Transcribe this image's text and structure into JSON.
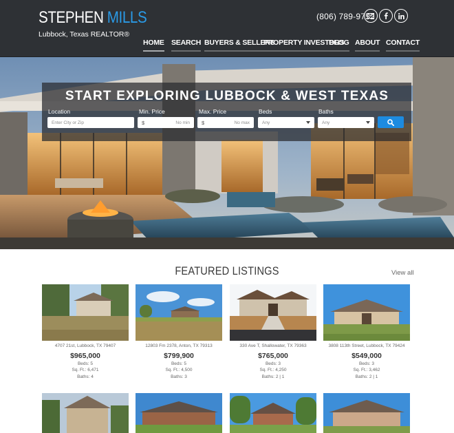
{
  "header": {
    "brand_first": "STEPHEN",
    "brand_last": "MILLS",
    "tagline": "Lubbock, Texas REALTOR®",
    "phone": "(806) 789-9752",
    "social": [
      "mail-icon",
      "facebook-icon",
      "linkedin-icon"
    ],
    "nav": [
      {
        "label": "HOME",
        "active": true
      },
      {
        "label": "SEARCH"
      },
      {
        "label": "BUYERS & SELLERS"
      },
      {
        "label": "PROPERTY INVESTORS"
      },
      {
        "label": "BLOG"
      },
      {
        "label": "ABOUT"
      },
      {
        "label": "CONTACT"
      }
    ]
  },
  "hero": {
    "title": "START EXPLORING LUBBOCK & WEST TEXAS",
    "fields": {
      "location_label": "Location",
      "location_placeholder": "Enter City or Zip",
      "min_price_label": "Min. Price",
      "min_price_symbol": "$",
      "min_price_placeholder": "No min",
      "max_price_label": "Max. Price",
      "max_price_symbol": "$",
      "max_price_placeholder": "No max",
      "beds_label": "Beds",
      "beds_value": "Any",
      "baths_label": "Baths",
      "baths_value": "Any"
    }
  },
  "featured": {
    "title": "FEATURED LISTINGS",
    "view_all": "View all",
    "listings": [
      {
        "address": "4707 21st, Lubbock, TX 79407",
        "price": "$965,000",
        "beds": "Beds: 5",
        "sqft": "Sq. Ft.: 6,471",
        "baths": "Baths: 4"
      },
      {
        "address": "12803 Fm 2378, Anton, TX 79313",
        "price": "$799,900",
        "beds": "Beds: 5",
        "sqft": "Sq. Ft.: 4,500",
        "baths": "Baths: 3"
      },
      {
        "address": "330 Ave T, Shallowater, TX 79363",
        "price": "$765,000",
        "beds": "Beds: 3",
        "sqft": "Sq. Ft.: 4,250",
        "baths": "Baths: 2 | 1"
      },
      {
        "address": "3808 113th Street, Lubbock, TX 79424",
        "price": "$549,000",
        "beds": "Beds: 3",
        "sqft": "Sq. Ft.: 3,462",
        "baths": "Baths: 2 | 1"
      }
    ]
  },
  "colors": {
    "header_bg": "#2e3135",
    "accent_blue": "#2a9ae6",
    "search_button": "#1d8be0"
  }
}
